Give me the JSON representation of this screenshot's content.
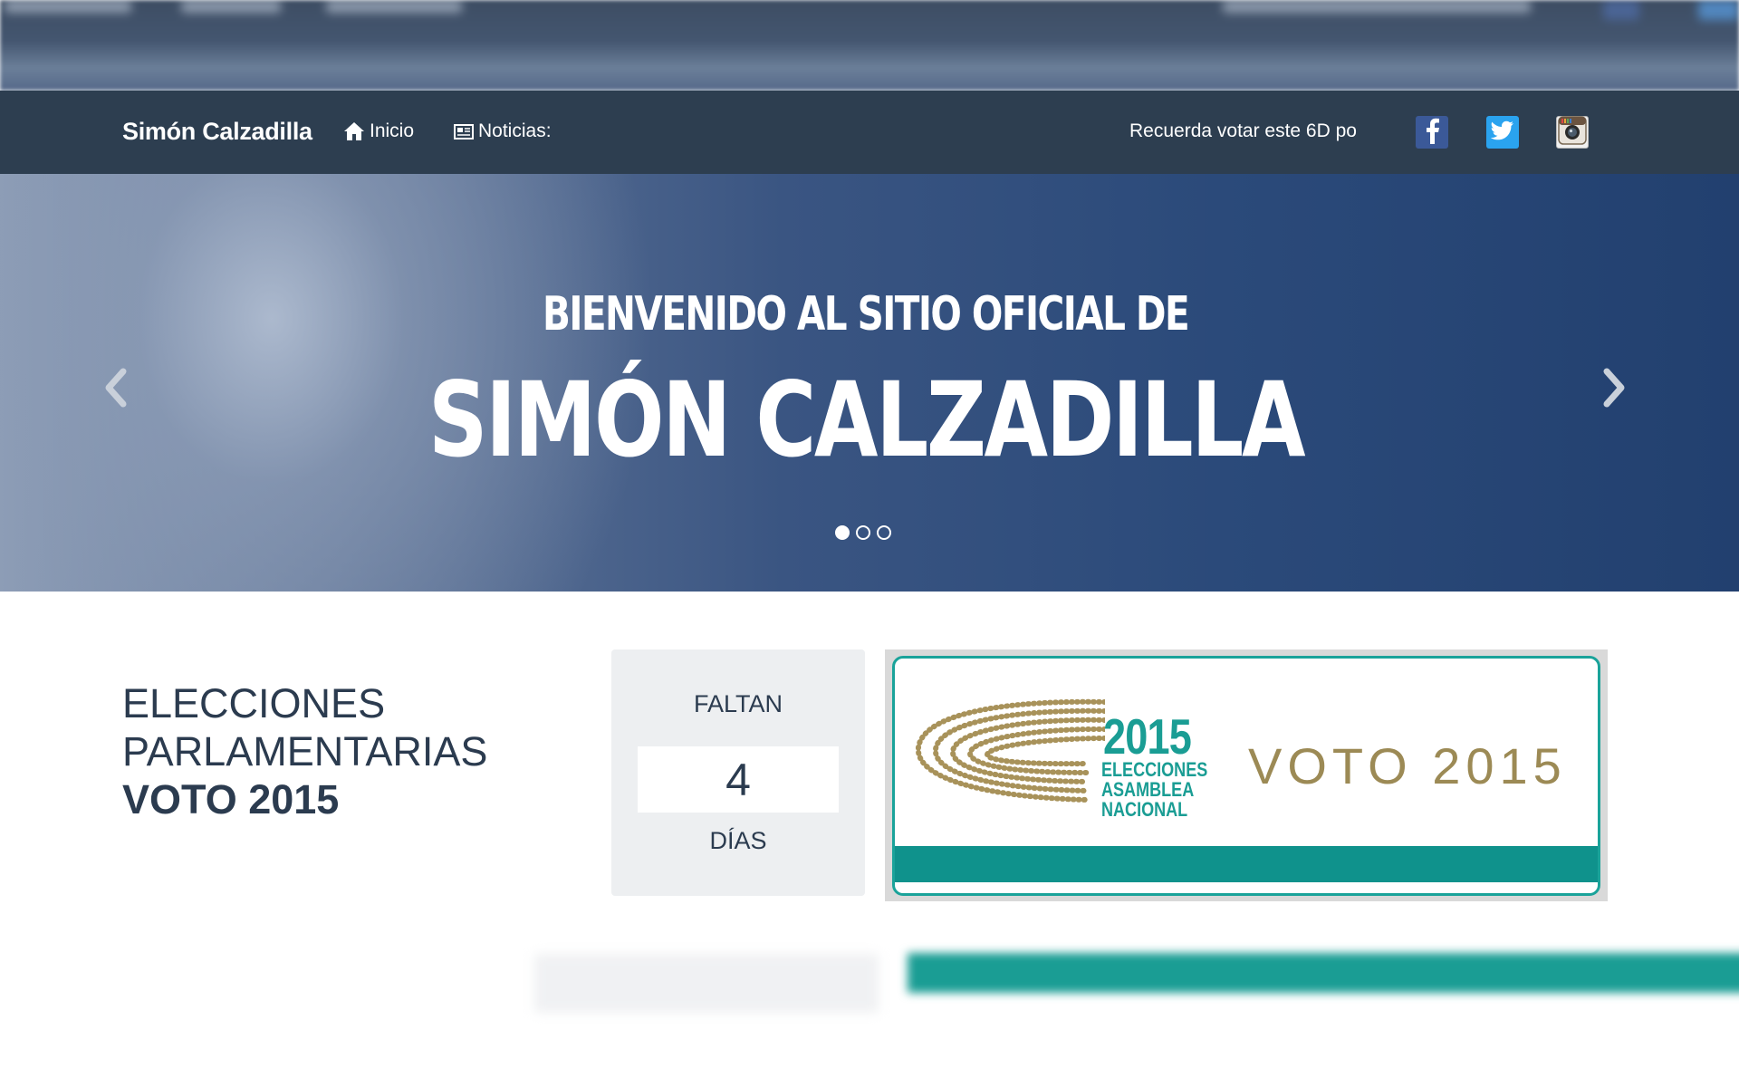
{
  "navbar": {
    "brand": "Simón Calzadilla",
    "links": [
      {
        "label": "Inicio",
        "icon": "home-icon"
      },
      {
        "label": "Noticias:",
        "icon": "newspaper-icon"
      }
    ],
    "ticker": "Recuerda votar este 6D po",
    "social": [
      {
        "name": "facebook",
        "icon": "facebook-icon",
        "color": "#3b5998"
      },
      {
        "name": "twitter",
        "icon": "twitter-icon",
        "color": "#2aa3ef"
      },
      {
        "name": "instagram",
        "icon": "instagram-icon",
        "color": "#f1f1f1"
      }
    ],
    "background": "#2d3e50"
  },
  "carousel": {
    "line1": "BIENVENIDO AL SITIO OFICIAL DE",
    "line2": "SIMÓN CALZADILLA",
    "indicator_count": 3,
    "active_index": 0
  },
  "election": {
    "title_line1": "ELECCIONES",
    "title_line2": "PARLAMENTARIAS",
    "title_line3": "VOTO 2015"
  },
  "countdown": {
    "label_top": "FALTAN",
    "value": "4",
    "label_bottom": "DÍAS"
  },
  "banner": {
    "year": "2015",
    "sub_line1": "ELECCIONES",
    "sub_line2": "ASAMBLEA",
    "sub_line3": "NACIONAL",
    "voto": "VOTO 2015",
    "accent_color": "#1a9d94",
    "gold_color": "#9c8a55"
  }
}
